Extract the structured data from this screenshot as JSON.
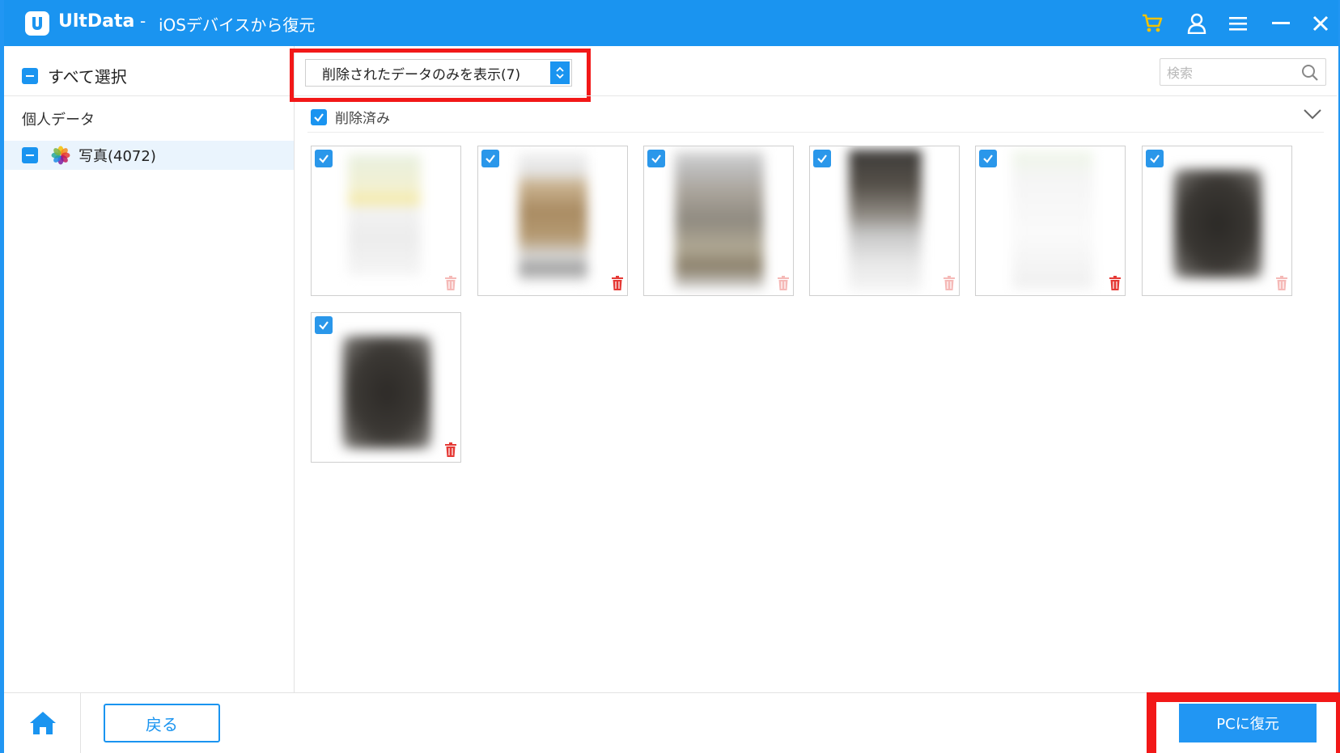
{
  "titlebar": {
    "app_name": "UltData",
    "separator": "-",
    "subtitle": "iOSデバイスから復元",
    "icons": [
      "logo-icon",
      "cart-icon",
      "user-icon",
      "menu-icon",
      "minimize-icon",
      "close-icon"
    ]
  },
  "sidebar": {
    "select_all_label": "すべて選択",
    "section_title": "個人データ",
    "category_label": "写真(4072)"
  },
  "toolbar": {
    "filter_value": "削除されたデータのみを表示(7)",
    "search_placeholder": "検索"
  },
  "group": {
    "label": "削除済み",
    "checked": true
  },
  "thumbnails": [
    {
      "checked": true,
      "style": "light-screenshot"
    },
    {
      "checked": true,
      "style": "brown-photo-screenshot"
    },
    {
      "checked": true,
      "style": "gray-photo-screenshot"
    },
    {
      "checked": true,
      "style": "dark-figure-photo"
    },
    {
      "checked": true,
      "style": "blank-screenshot"
    },
    {
      "checked": true,
      "style": "dark-square-photo"
    },
    {
      "checked": true,
      "style": "dark-square-photo"
    }
  ],
  "bottom": {
    "back_label": "戻る",
    "recover_label": "PCに復元"
  },
  "colors": {
    "accent": "#1a94f0",
    "highlight": "#f21818",
    "trash": "#e53935"
  }
}
